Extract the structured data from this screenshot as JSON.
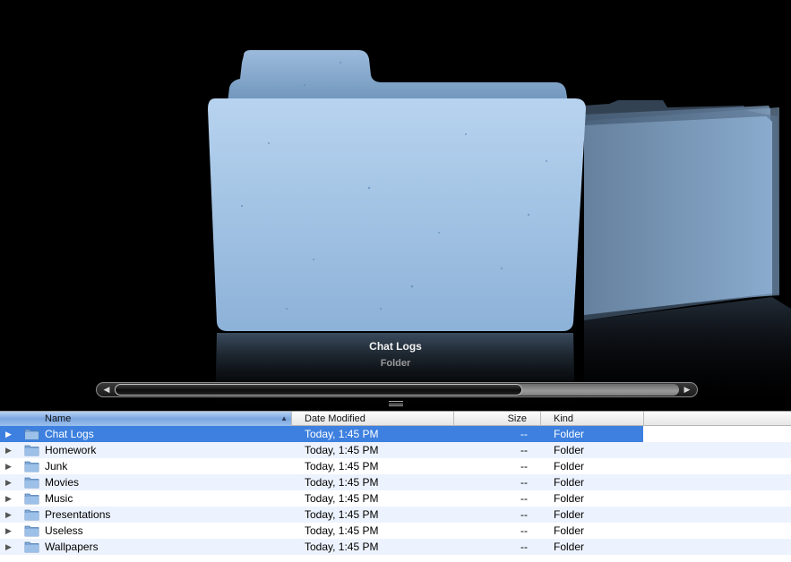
{
  "coverflow": {
    "selected_title": "Chat Logs",
    "selected_kind": "Folder",
    "folder_color": "#a9c7e6",
    "background": "#000000",
    "scroll_position": 0.72
  },
  "listview": {
    "columns": {
      "name": "Name",
      "date_modified": "Date Modified",
      "size": "Size",
      "kind": "Kind"
    },
    "sort_indicator": "▲",
    "selection_color": "#3d80df",
    "rows": [
      {
        "name": "Chat Logs",
        "date": "Today, 1:45 PM",
        "size": "--",
        "kind": "Folder",
        "selected": true
      },
      {
        "name": "Homework",
        "date": "Today, 1:45 PM",
        "size": "--",
        "kind": "Folder"
      },
      {
        "name": "Junk",
        "date": "Today, 1:45 PM",
        "size": "--",
        "kind": "Folder"
      },
      {
        "name": "Movies",
        "date": "Today, 1:45 PM",
        "size": "--",
        "kind": "Folder"
      },
      {
        "name": "Music",
        "date": "Today, 1:45 PM",
        "size": "--",
        "kind": "Folder"
      },
      {
        "name": "Presentations",
        "date": "Today, 1:45 PM",
        "size": "--",
        "kind": "Folder"
      },
      {
        "name": "Useless",
        "date": "Today, 1:45 PM",
        "size": "--",
        "kind": "Folder"
      },
      {
        "name": "Wallpapers",
        "date": "Today, 1:45 PM",
        "size": "--",
        "kind": "Folder"
      }
    ]
  }
}
